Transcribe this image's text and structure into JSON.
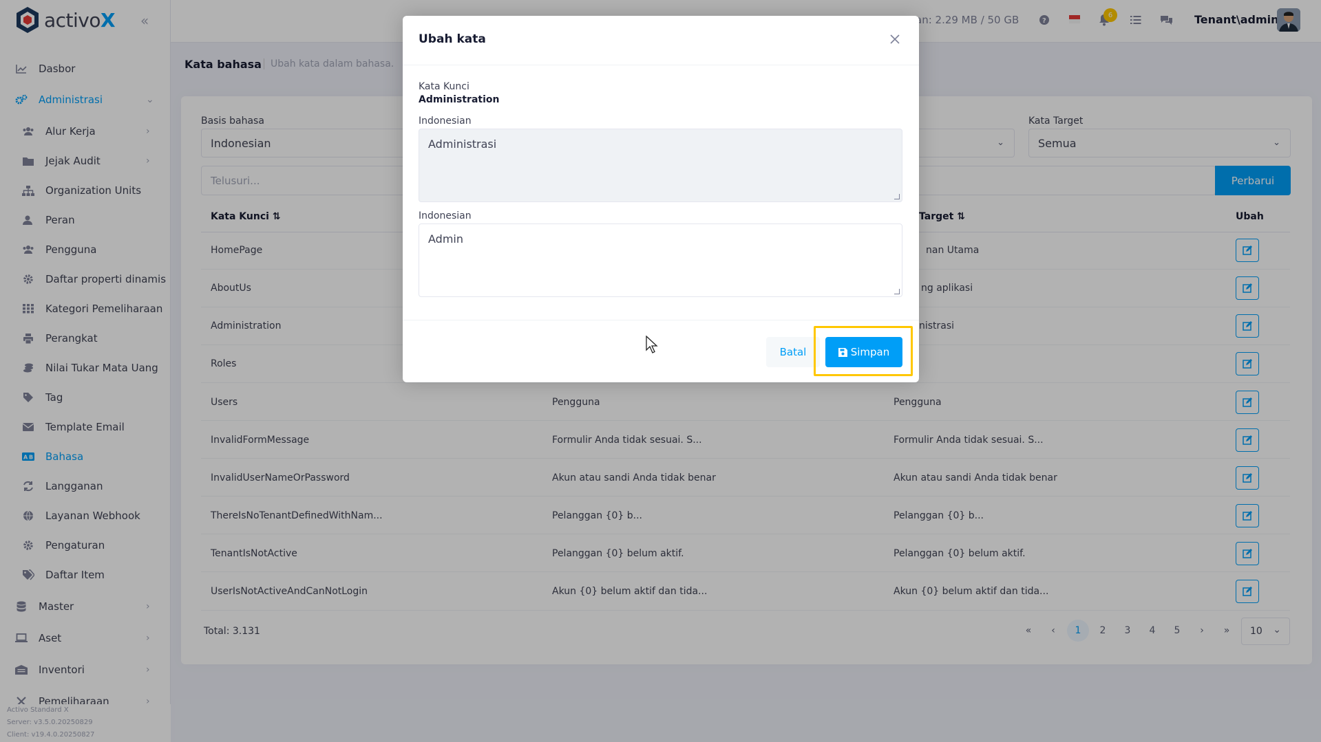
{
  "app": {
    "name": "activo",
    "name_x": "X"
  },
  "sidebar": {
    "items": [
      {
        "label": "Dasbor",
        "icon": "chart-line-icon"
      },
      {
        "label": "Administrasi",
        "icon": "cogs-icon",
        "active": true,
        "expanded": true
      },
      {
        "label": "Alur Kerja",
        "icon": "users-icon"
      },
      {
        "label": "Jejak Audit",
        "icon": "folder-icon"
      },
      {
        "label": "Organization Units",
        "icon": "sitemap-icon"
      },
      {
        "label": "Peran",
        "icon": "user-icon"
      },
      {
        "label": "Pengguna",
        "icon": "users-icon"
      },
      {
        "label": "Daftar properti dinamis",
        "icon": "gear-icon"
      },
      {
        "label": "Kategori Pemeliharaan",
        "icon": "grid-icon"
      },
      {
        "label": "Perangkat",
        "icon": "printer-icon"
      },
      {
        "label": "Nilai Tukar Mata Uang",
        "icon": "coins-icon"
      },
      {
        "label": "Tag",
        "icon": "tag-icon"
      },
      {
        "label": "Template Email",
        "icon": "envelope-icon"
      },
      {
        "label": "Bahasa",
        "icon": "language-icon",
        "active": true
      },
      {
        "label": "Langganan",
        "icon": "refresh-icon"
      },
      {
        "label": "Layanan Webhook",
        "icon": "globe-icon"
      },
      {
        "label": "Pengaturan",
        "icon": "gear-icon"
      },
      {
        "label": "Daftar Item",
        "icon": "tags-icon"
      },
      {
        "label": "Master",
        "icon": "database-icon"
      },
      {
        "label": "Aset",
        "icon": "laptop-icon"
      },
      {
        "label": "Inventori",
        "icon": "warehouse-icon"
      },
      {
        "label": "Pemeliharaan",
        "icon": "tools-icon"
      }
    ],
    "footer": [
      "Activo Standard X",
      "Server: v3.5.0.20250829",
      "Client: v19.4.0.20250827"
    ]
  },
  "topbar": {
    "storage": "an: 2.29 MB / 50 GB",
    "notification_count": "6",
    "user": "Tenant\\admin"
  },
  "page": {
    "title": "Kata bahasa",
    "subtitle": "Ubah kata dalam bahasa."
  },
  "filters": {
    "base_label": "Basis bahasa",
    "base_value": "Indonesian",
    "target_label": "Kata Target",
    "target_value": "Semua",
    "search_placeholder": "Telusuri...",
    "refresh_label": "Perbarui"
  },
  "table": {
    "headers": {
      "key": "Kata Kunci",
      "target": "Target",
      "edit": "Ubah"
    },
    "partial_rows": [
      {
        "key": "HomePage",
        "target": "nan Utama"
      },
      {
        "key": "AboutUs",
        "target": "ng aplikasi"
      },
      {
        "key": "Administration",
        "target": "nistrasi"
      },
      {
        "key": "Roles",
        "target": ""
      }
    ],
    "rows": [
      {
        "key": "Users",
        "base": "Pengguna",
        "target": "Pengguna"
      },
      {
        "key": "InvalidFormMessage",
        "base": "Formulir Anda tidak sesuai. S...",
        "target": "Formulir Anda tidak sesuai. S..."
      },
      {
        "key": "InvalidUserNameOrPassword",
        "base": "Akun atau sandi Anda tidak benar",
        "target": "Akun atau sandi Anda tidak benar"
      },
      {
        "key": "ThereIsNoTenantDefinedWithNam...",
        "base": "Pelanggan {0} b...",
        "target": "Pelanggan {0} b..."
      },
      {
        "key": "TenantIsNotActive",
        "base": "Pelanggan {0} belum aktif.",
        "target": "Pelanggan {0} belum aktif."
      },
      {
        "key": "UserIsNotActiveAndCanNotLogin",
        "base": "Akun {0} belum aktif dan tida...",
        "target": "Akun {0} belum aktif dan tida..."
      }
    ],
    "total": "Total: 3.131",
    "pages": [
      "1",
      "2",
      "3",
      "4",
      "5"
    ],
    "current_page": "1",
    "page_size": "10"
  },
  "modal": {
    "title": "Ubah kata",
    "key_label": "Kata Kunci",
    "key_value": "Administration",
    "base_label": "Indonesian",
    "base_text": "Administrasi",
    "target_label": "Indonesian",
    "target_text": "Admin",
    "cancel_label": "Batal",
    "save_label": "Simpan"
  },
  "colors": {
    "accent": "#009ef7",
    "highlight": "#ffc700"
  }
}
